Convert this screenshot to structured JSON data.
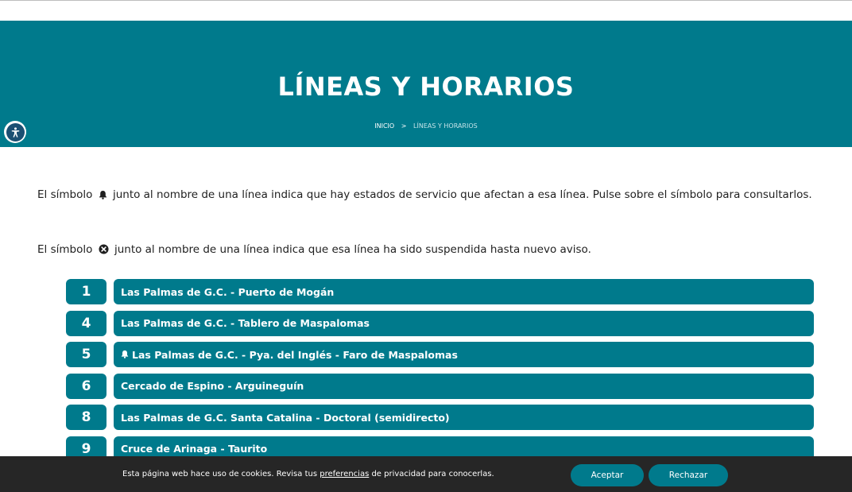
{
  "header": {
    "title": "LÍNEAS Y HORARIOS",
    "breadcrumb": {
      "home": "INICIO",
      "separator": ">",
      "current": "LÍNEAS Y HORARIOS"
    }
  },
  "accessibility": {
    "icon": "accessibility-icon"
  },
  "info": {
    "bell_part1": "El símbolo",
    "bell_part2": "junto al nombre de una línea indica que hay estados de servicio que afectan a esa línea. Pulse sobre el símbolo para consultarlos.",
    "cancel_part1": "El símbolo",
    "cancel_part2": "junto al nombre de una línea indica que esa línea ha sido suspendida hasta nuevo aviso."
  },
  "lines": [
    {
      "number": "1",
      "name": "Las Palmas de G.C. - Puerto de Mogán",
      "alert": false
    },
    {
      "number": "4",
      "name": "Las Palmas de G.C. - Tablero de Maspalomas",
      "alert": false
    },
    {
      "number": "5",
      "name": "Las Palmas de G.C. - Pya. del Inglés - Faro de Maspalomas",
      "alert": true
    },
    {
      "number": "6",
      "name": "Cercado de Espino - Arguineguín",
      "alert": false
    },
    {
      "number": "8",
      "name": "Las Palmas de G.C. Santa Catalina - Doctoral (semidirecto)",
      "alert": false
    },
    {
      "number": "9",
      "name": "Cruce de Arinaga - Taurito",
      "alert": false
    }
  ],
  "cookie": {
    "text_before": "Esta página web hace uso de cookies. Revisa tus ",
    "link": "preferencias",
    "text_after": " de privacidad para conocerlas.",
    "accept": "Aceptar",
    "reject": "Rechazar"
  },
  "colors": {
    "brand": "#007a8c",
    "cookie_bg": "#262626",
    "text": "#1f1f1f"
  }
}
